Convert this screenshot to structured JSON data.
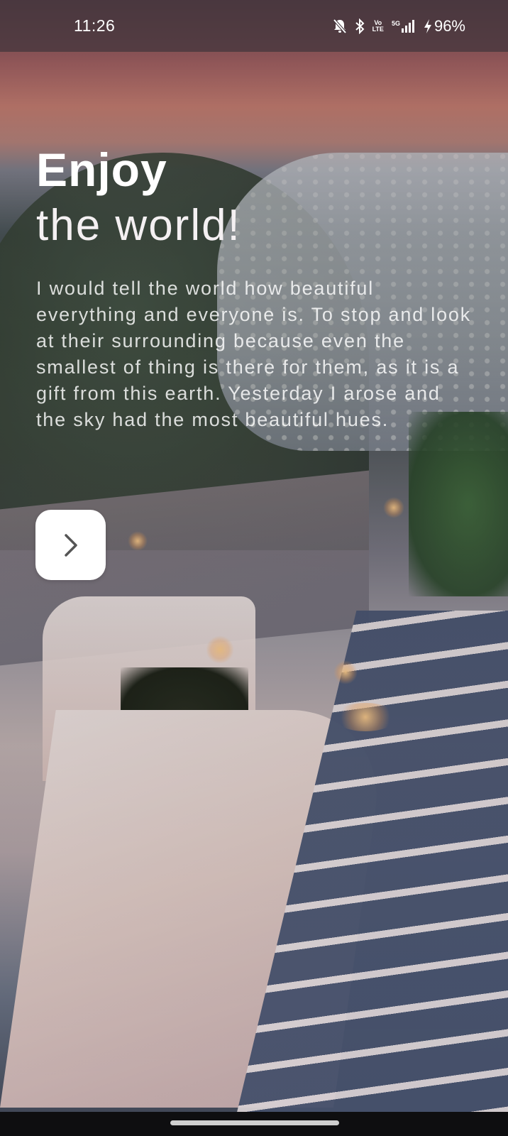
{
  "status_bar": {
    "time": "11:26",
    "volte_line1": "Vo",
    "volte_line2": "LTE",
    "network": "5G",
    "battery_percent": "96%",
    "icons": [
      "mute-bell-icon",
      "bluetooth-icon",
      "volte-icon",
      "signal-icon",
      "charging-icon"
    ]
  },
  "hero": {
    "title_bold": "Enjoy",
    "title_light": "the world!",
    "description": "I would tell the world how beautiful everything and everyone is. To stop and look at their surrounding because even the smallest of thing is there for them, as it is a gift from this earth. Yesterday I arose and the sky had the most beautiful hues."
  },
  "next_button": {
    "icon": "chevron-right-icon",
    "icon_color": "#555555",
    "background": "#ffffff"
  },
  "colors": {
    "text": "#ffffff",
    "status_bar_bg": "#46373e"
  }
}
